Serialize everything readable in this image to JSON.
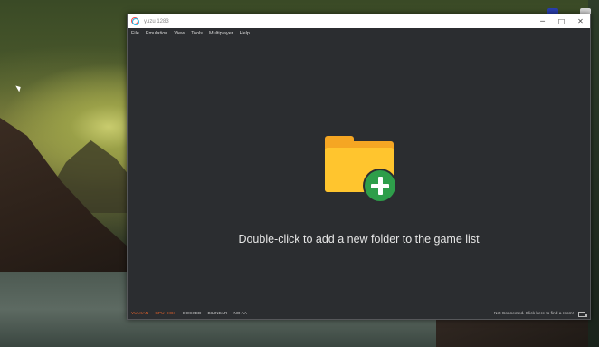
{
  "window": {
    "title": "yuzu 1283",
    "controls": {
      "minimize": "─",
      "maximize": "□",
      "close": "✕"
    }
  },
  "menu": [
    {
      "label": "File"
    },
    {
      "label": "Emulation"
    },
    {
      "label": "View"
    },
    {
      "label": "Tools"
    },
    {
      "label": "Multiplayer"
    },
    {
      "label": "Help"
    }
  ],
  "content": {
    "hint": "Double-click to add a new folder to the game list",
    "icon": "folder-add-icon"
  },
  "status": {
    "items": [
      {
        "label": "VULKAN",
        "accent": true
      },
      {
        "label": "GPU HIGH",
        "accent": true
      },
      {
        "label": "DOCKED",
        "accent": false
      },
      {
        "label": "BILINEAR",
        "accent": false
      },
      {
        "label": "NO AA",
        "accent": false
      }
    ],
    "room": "Not Connected. Click here to find a room!"
  },
  "colors": {
    "accent": "#e0602b",
    "folder": "#ffc52e",
    "plus": "#2e9e4a",
    "background": "#2b2d30"
  }
}
